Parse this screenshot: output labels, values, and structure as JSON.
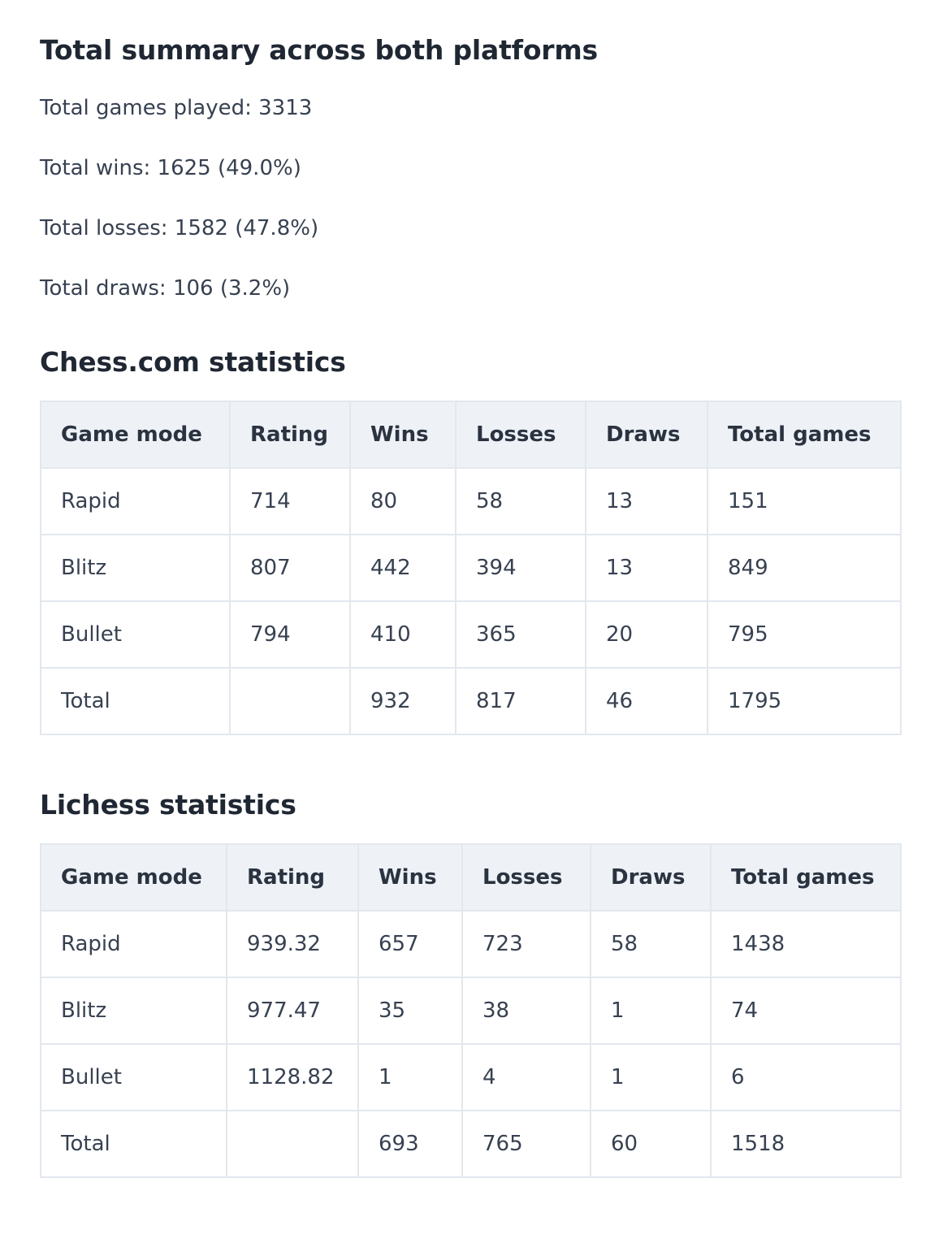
{
  "summary": {
    "title": "Total summary across both platforms",
    "lines": [
      "Total games played: 3313",
      "Total wins: 1625 (49.0%)",
      "Total losses: 1582 (47.8%)",
      "Total draws: 106 (3.2%)"
    ]
  },
  "chesscom": {
    "title": "Chess.com statistics",
    "headers": [
      "Game mode",
      "Rating",
      "Wins",
      "Losses",
      "Draws",
      "Total games"
    ],
    "rows": [
      [
        "Rapid",
        "714",
        "80",
        "58",
        "13",
        "151"
      ],
      [
        "Blitz",
        "807",
        "442",
        "394",
        "13",
        "849"
      ],
      [
        "Bullet",
        "794",
        "410",
        "365",
        "20",
        "795"
      ],
      [
        "Total",
        "",
        "932",
        "817",
        "46",
        "1795"
      ]
    ]
  },
  "lichess": {
    "title": "Lichess statistics",
    "headers": [
      "Game mode",
      "Rating",
      "Wins",
      "Losses",
      "Draws",
      "Total games"
    ],
    "rows": [
      [
        "Rapid",
        "939.32",
        "657",
        "723",
        "58",
        "1438"
      ],
      [
        "Blitz",
        "977.47",
        "35",
        "38",
        "1",
        "74"
      ],
      [
        "Bullet",
        "1128.82",
        "1",
        "4",
        "1",
        "6"
      ],
      [
        "Total",
        "",
        "693",
        "765",
        "60",
        "1518"
      ]
    ]
  }
}
